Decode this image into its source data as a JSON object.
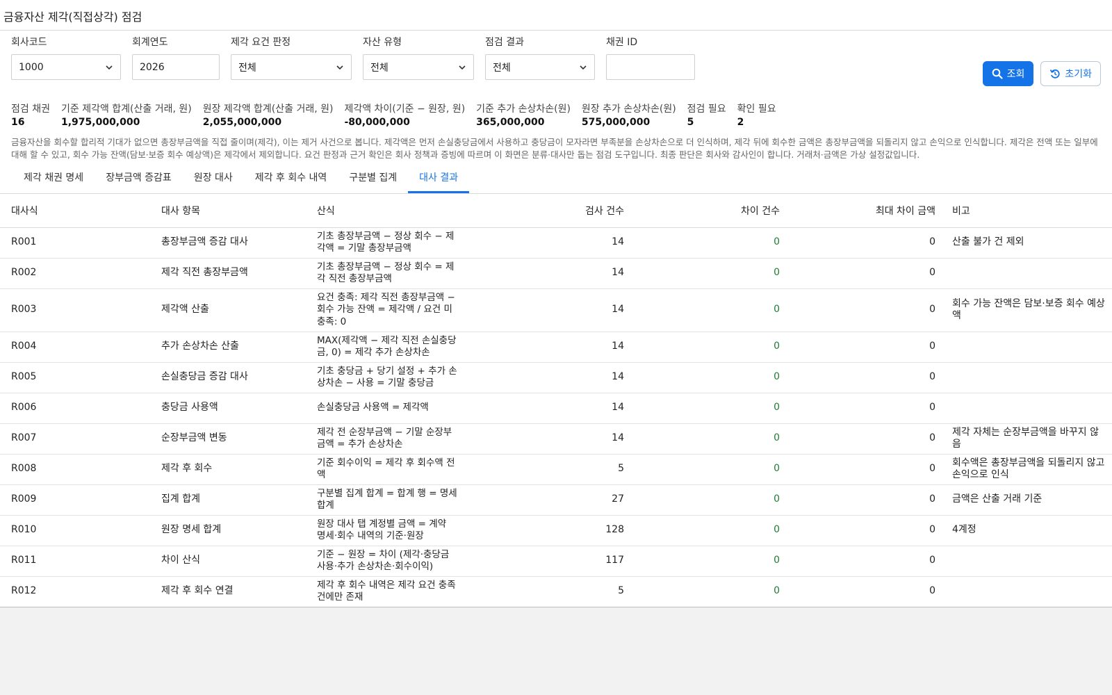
{
  "title": "금융자산 제각(직접상각) 점검",
  "filters": {
    "company_code": {
      "label": "회사코드",
      "value": "1000"
    },
    "fiscal_year": {
      "label": "회계연도",
      "value": "2026"
    },
    "writeoff_judgment": {
      "label": "제각 요건 판정",
      "value": "전체"
    },
    "asset_type": {
      "label": "자산 유형",
      "value": "전체"
    },
    "check_result": {
      "label": "점검 결과",
      "value": "전체"
    },
    "bond_id": {
      "label": "채권 ID",
      "value": ""
    }
  },
  "buttons": {
    "search": "조회",
    "reset": "초기화"
  },
  "summary": [
    {
      "label": "점검 채권",
      "value": "16"
    },
    {
      "label": "기준 제각액 합계(산출 거래, 원)",
      "value": "1,975,000,000"
    },
    {
      "label": "원장 제각액 합계(산출 거래, 원)",
      "value": "2,055,000,000"
    },
    {
      "label": "제각액 차이(기준 − 원장, 원)",
      "value": "-80,000,000"
    },
    {
      "label": "기준 추가 손상차손(원)",
      "value": "365,000,000"
    },
    {
      "label": "원장 추가 손상차손(원)",
      "value": "575,000,000"
    },
    {
      "label": "점검 필요",
      "value": "5"
    },
    {
      "label": "확인 필요",
      "value": "2"
    }
  ],
  "note": "금융자산을 회수할 합리적 기대가 없으면 총장부금액을 직접 줄이며(제각), 이는 제거 사건으로 봅니다. 제각액은 먼저 손실충당금에서 사용하고 충당금이 모자라면 부족분을 손상차손으로 더 인식하며, 제각 뒤에 회수한 금액은 총장부금액을 되돌리지 않고 손익으로 인식합니다. 제각은 전액 또는 일부에 대해 할 수 있고, 회수 가능 잔액(담보·보증 회수 예상액)은 제각에서 제외합니다. 요건 판정과 근거 확인은 회사 정책과 증빙에 따르며 이 화면은 분류·대사만 돕는 점검 도구입니다. 최종 판단은 회사와 감사인이 합니다. 거래처·금액은 가상 설정값입니다.",
  "tabs": [
    "제각 채권 명세",
    "장부금액 증감표",
    "원장 대사",
    "제각 후 회수 내역",
    "구분별 집계",
    "대사 결과"
  ],
  "active_tab": 5,
  "table": {
    "headers": [
      "대사식",
      "대사 항목",
      "산식",
      "검사 건수",
      "차이 건수",
      "최대 차이 금액",
      "비고"
    ],
    "rows": [
      {
        "id": "R001",
        "item": "총장부금액 증감 대사",
        "formula": "기초 총장부금액 − 정상 회수 − 제각액 = 기말 총장부금액",
        "count": "14",
        "diff": "0",
        "max": "0",
        "remark": "산출 불가 건 제외"
      },
      {
        "id": "R002",
        "item": "제각 직전 총장부금액",
        "formula": "기초 총장부금액 − 정상 회수 = 제각 직전 총장부금액",
        "count": "14",
        "diff": "0",
        "max": "0",
        "remark": ""
      },
      {
        "id": "R003",
        "item": "제각액 산출",
        "formula": "요건 충족: 제각 직전 총장부금액 − 회수 가능 잔액 = 제각액 / 요건 미충족: 0",
        "count": "14",
        "diff": "0",
        "max": "0",
        "remark": "회수 가능 잔액은 담보·보증 회수 예상액"
      },
      {
        "id": "R004",
        "item": "추가 손상차손 산출",
        "formula": "MAX(제각액 − 제각 직전 손실충당금, 0) = 제각 추가 손상차손",
        "count": "14",
        "diff": "0",
        "max": "0",
        "remark": ""
      },
      {
        "id": "R005",
        "item": "손실충당금 증감 대사",
        "formula": "기초 충당금 + 당기 설정 + 추가 손상차손 − 사용 = 기말 충당금",
        "count": "14",
        "diff": "0",
        "max": "0",
        "remark": ""
      },
      {
        "id": "R006",
        "item": "충당금 사용액",
        "formula": "손실충당금 사용액 = 제각액",
        "count": "14",
        "diff": "0",
        "max": "0",
        "remark": ""
      },
      {
        "id": "R007",
        "item": "순장부금액 변동",
        "formula": "제각 전 순장부금액 − 기말 순장부금액 = 추가 손상차손",
        "count": "14",
        "diff": "0",
        "max": "0",
        "remark": "제각 자체는 순장부금액을 바꾸지 않음"
      },
      {
        "id": "R008",
        "item": "제각 후 회수",
        "formula": "기준 회수이익 = 제각 후 회수액 전액",
        "count": "5",
        "diff": "0",
        "max": "0",
        "remark": "회수액은 총장부금액을 되돌리지 않고 손익으로 인식"
      },
      {
        "id": "R009",
        "item": "집계 합계",
        "formula": "구분별 집계 합계 = 합계 행 = 명세 합계",
        "count": "27",
        "diff": "0",
        "max": "0",
        "remark": "금액은 산출 거래 기준"
      },
      {
        "id": "R010",
        "item": "원장 명세 합계",
        "formula": "원장 대사 탭 계정별 금액 = 계약 명세·회수 내역의 기준·원장",
        "count": "128",
        "diff": "0",
        "max": "0",
        "remark": "4계정"
      },
      {
        "id": "R011",
        "item": "차이 산식",
        "formula": "기준 − 원장 = 차이 (제각·충당금 사용·추가 손상차손·회수이익)",
        "count": "117",
        "diff": "0",
        "max": "0",
        "remark": ""
      },
      {
        "id": "R012",
        "item": "제각 후 회수 연결",
        "formula": "제각 후 회수 내역은 제각 요건 충족 건에만 존재",
        "count": "5",
        "diff": "0",
        "max": "0",
        "remark": ""
      }
    ]
  }
}
